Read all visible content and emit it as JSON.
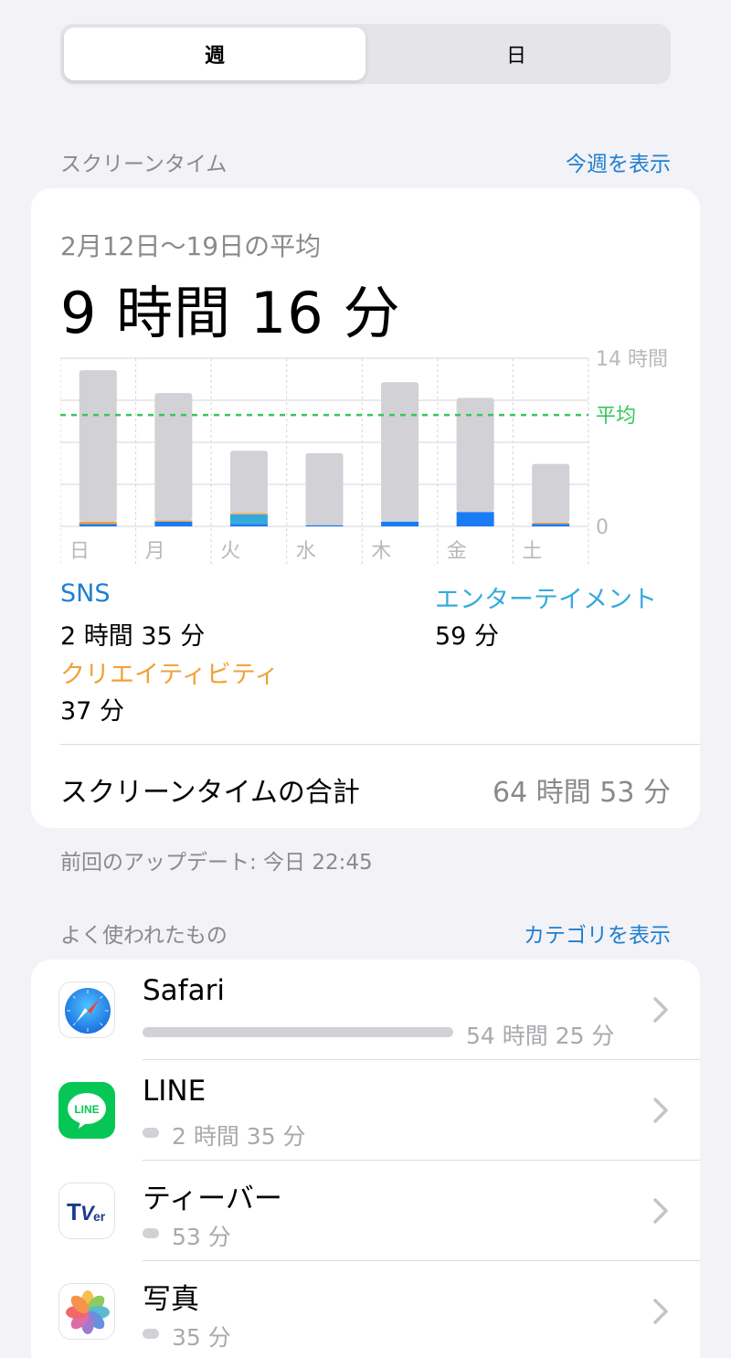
{
  "tabs": [
    {
      "label": "週",
      "active": true
    },
    {
      "label": "日",
      "active": false
    }
  ],
  "screen_time": {
    "section_title": "スクリーンタイム",
    "section_link": "今週を表示",
    "avg_label": "2月12日〜19日の平均",
    "avg_value": "9 時間 16 分",
    "categories": [
      {
        "name": "SNS",
        "value": "2 時間 35 分",
        "color": "#1f7fd0"
      },
      {
        "name": "エンターテイメント",
        "value": "59 分",
        "color": "#34aadc"
      },
      {
        "name": "クリエイティビティ",
        "value": "37 分",
        "color": "#f0a23a"
      }
    ],
    "total_label": "スクリーンタイムの合計",
    "total_value": "64 時間 53 分",
    "updated": "前回のアップデート: 今日 22:45"
  },
  "chart_data": {
    "type": "bar",
    "categories": [
      "日",
      "月",
      "火",
      "水",
      "木",
      "金",
      "土"
    ],
    "ylim": [
      0,
      14
    ],
    "y_tick_labels": [
      "14 時間",
      "0"
    ],
    "average_label": "平均",
    "average_value": 9.27,
    "series": [
      {
        "values": [
          0.2,
          0.4,
          0.2,
          0.1,
          0.4,
          1.2,
          0.2
        ],
        "color": "#1a7cf5"
      },
      {
        "values": [
          0.0,
          0.0,
          0.8,
          0.0,
          0.0,
          0.0,
          0.0
        ],
        "color": "#34aadc"
      },
      {
        "values": [
          0.2,
          0.1,
          0.1,
          0.0,
          0.0,
          0.0,
          0.1
        ],
        "color": "#f0a23a"
      },
      {
        "values": [
          12.6,
          10.6,
          5.2,
          6.0,
          11.6,
          9.5,
          4.9
        ],
        "color": "#d1d1d6"
      }
    ],
    "colors": {
      "average_line": "#34c759",
      "grid": "#d6d6db"
    }
  },
  "most_used": {
    "section_title": "よく使われたもの",
    "section_link": "カテゴリを表示",
    "apps": [
      {
        "name": "Safari",
        "time": "54 時間 25 分",
        "icon": "safari-icon",
        "fraction": 1.0
      },
      {
        "name": "LINE",
        "time": "2 時間 35 分",
        "icon": "line-icon",
        "fraction": 0.047
      },
      {
        "name": "ティーバー",
        "time": "53 分",
        "icon": "tver-icon",
        "fraction": 0.016
      },
      {
        "name": "写真",
        "time": "35 分",
        "icon": "photos-icon",
        "fraction": 0.011
      }
    ]
  }
}
